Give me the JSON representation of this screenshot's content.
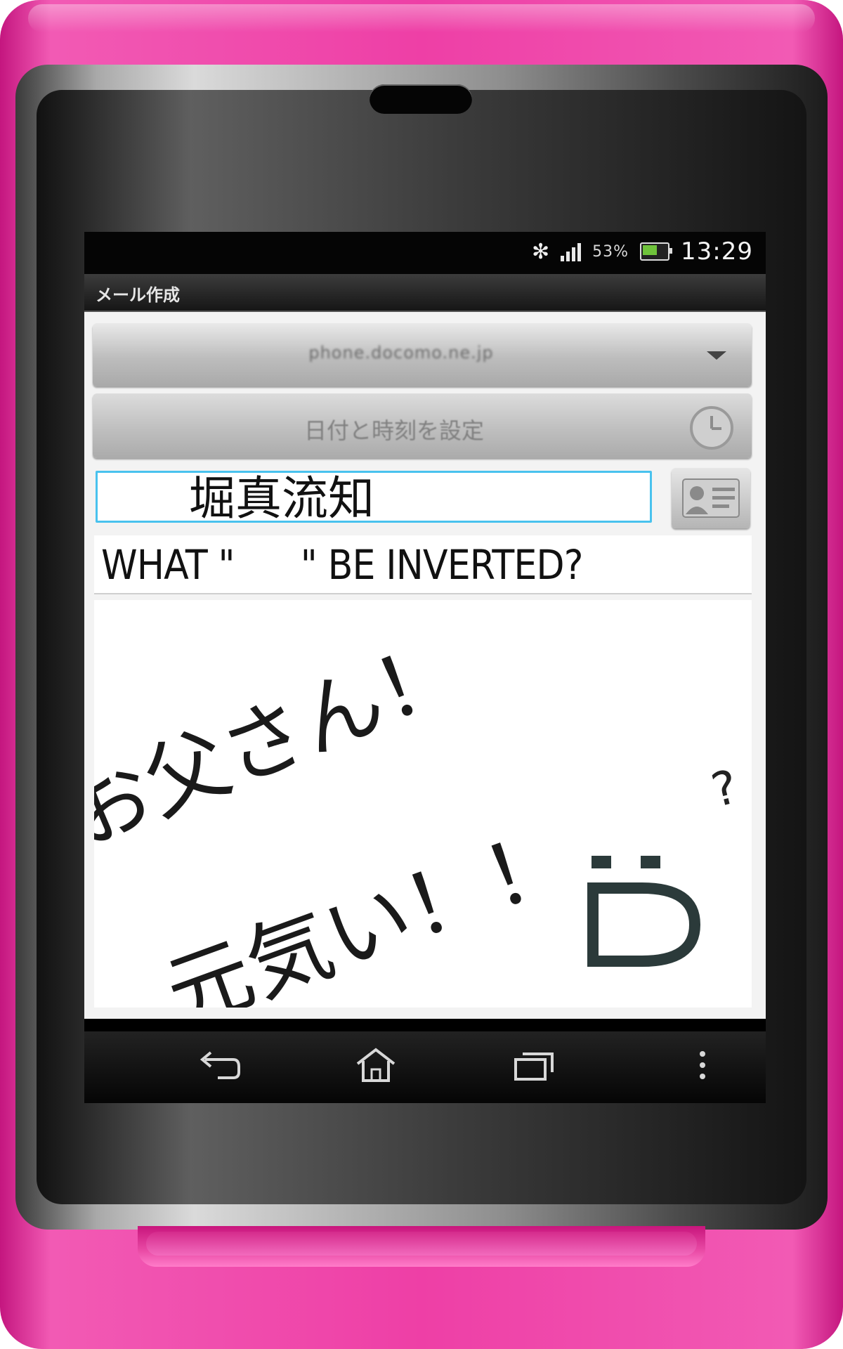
{
  "status_bar": {
    "battery_percent": "53%",
    "time": "13:29"
  },
  "title_bar": {
    "title": "メール作成"
  },
  "compose": {
    "sender_account": "phone.docomo.ne.jp",
    "datetime_label": "日付と時刻を設定",
    "recipient_name": "堀真流知",
    "subject": "WHAT \"      \" BE INVERTED?",
    "body_line1": "お父さん！",
    "body_line2": "元気い！！",
    "body_mark": "?"
  },
  "icons": {
    "sender": "chevron-down-icon",
    "datetime": "clock-icon",
    "contact": "contact-card-icon",
    "nav": [
      "back-icon",
      "home-icon",
      "recent-apps-icon",
      "menu-icon"
    ]
  },
  "colors": {
    "phone_shell": "#ee3fa6",
    "recipient_focus": "#49c2ee",
    "battery": "#6fc33b"
  }
}
